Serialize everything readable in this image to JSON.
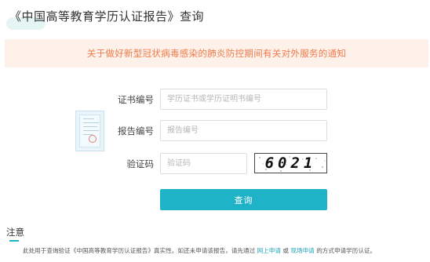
{
  "header": {
    "title": "《中国高等教育学历认证报告》查询"
  },
  "notice": {
    "text": "关于做好新型冠状病毒感染的肺炎防控期间有关对外服务的通知"
  },
  "form": {
    "cert_number": {
      "label": "证书编号",
      "placeholder": "学历证书或学历证明书编号"
    },
    "report_number": {
      "label": "报告编号",
      "placeholder": "报告编号"
    },
    "captcha": {
      "label": "验证码",
      "placeholder": "验证码",
      "image_text": "6021"
    },
    "submit_label": "查询"
  },
  "note": {
    "heading": "注意",
    "text_before": "此处用于查询验证《中国高等教育学历认证报告》真实性。如还未申请该报告，请先通过",
    "link_online": "网上申请",
    "text_or": "或",
    "link_onsite": "现场申请",
    "text_after": "的方式申请学历认证。"
  },
  "colors": {
    "accent": "#1fb3c8",
    "notice_bg": "#fdf1ea",
    "notice_text": "#f07a4a"
  }
}
